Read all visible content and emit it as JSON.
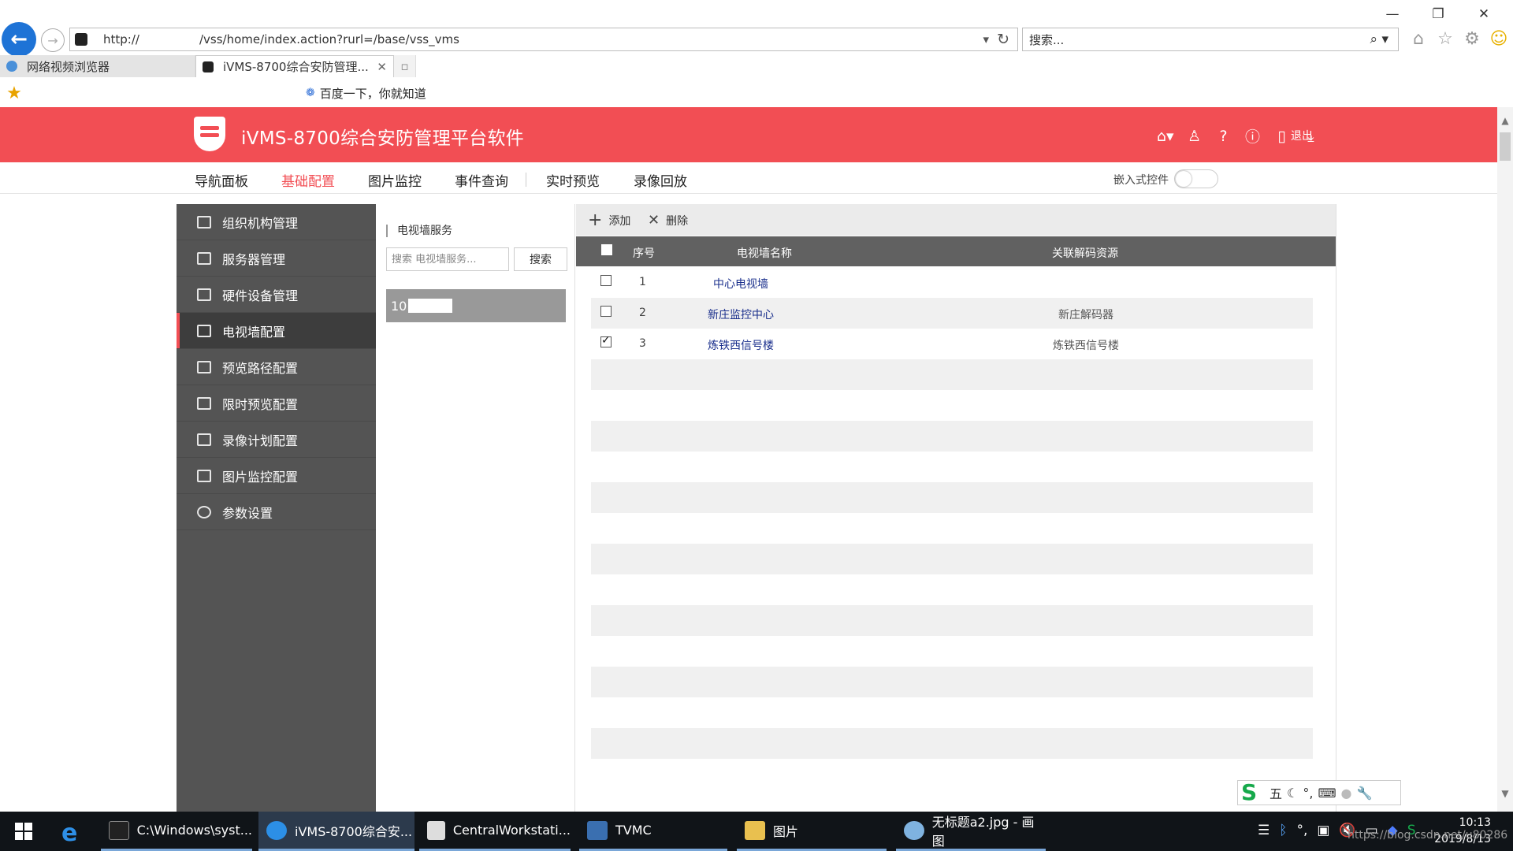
{
  "browser": {
    "url_visible_start": "http://",
    "url_path": "/vss/home/index.action?rurl=/base/vss_vms",
    "search_placeholder": "搜索...",
    "tabs": [
      {
        "label": "网络视频浏览器",
        "active": false
      },
      {
        "label": "iVMS-8700综合安防管理...",
        "active": true
      }
    ],
    "favorites": [
      {
        "label": "百度一下，你就知道"
      }
    ],
    "window_controls": [
      "—",
      "❐",
      "✕"
    ]
  },
  "app": {
    "title": "iVMS-8700综合安防管理平台软件",
    "logout_label": "退出",
    "accent": "#f24e54",
    "header_icons": [
      "home-icon",
      "user-icon",
      "help-icon",
      "info-icon",
      "bookmark-icon",
      "download-icon"
    ]
  },
  "menu": {
    "items": [
      {
        "label": "导航面板",
        "active": false
      },
      {
        "label": "基础配置",
        "active": true
      },
      {
        "label": "图片监控",
        "active": false
      },
      {
        "label": "事件查询",
        "active": false
      },
      {
        "label": "实时预览",
        "active": false
      },
      {
        "label": "录像回放",
        "active": false
      }
    ],
    "embed_label": "嵌入式控件",
    "embed_on": false
  },
  "sidebar": {
    "items": [
      {
        "label": "组织机构管理",
        "icon": "org-icon"
      },
      {
        "label": "服务器管理",
        "icon": "server-icon"
      },
      {
        "label": "硬件设备管理",
        "icon": "hardware-icon"
      },
      {
        "label": "电视墙配置",
        "icon": "monitor-icon",
        "active": true
      },
      {
        "label": "预览路径配置",
        "icon": "preview-path-icon"
      },
      {
        "label": "限时预览配置",
        "icon": "timed-preview-icon"
      },
      {
        "label": "录像计划配置",
        "icon": "record-plan-icon"
      },
      {
        "label": "图片监控配置",
        "icon": "picture-monitor-icon"
      },
      {
        "label": "参数设置",
        "icon": "gear-icon"
      }
    ]
  },
  "middle": {
    "title": "电视墙服务",
    "search_placeholder": "搜索 电视墙服务...",
    "search_button": "搜索",
    "selected_item_prefix": "10"
  },
  "toolbar": {
    "add_label": "添加",
    "delete_label": "删除"
  },
  "table": {
    "columns": [
      "序号",
      "电视墙名称",
      "关联解码资源"
    ],
    "rows": [
      {
        "index": "1",
        "name": "中心电视墙",
        "resource": "",
        "checked": false
      },
      {
        "index": "2",
        "name": "新庄监控中心",
        "resource": "新庄解码器",
        "checked": false
      },
      {
        "index": "3",
        "name": "炼铁西信号楼",
        "resource": "炼铁西信号楼",
        "checked": true
      }
    ]
  },
  "ime": {
    "mode": "五"
  },
  "taskbar": {
    "items": [
      {
        "label": "C:\\Windows\\syst..."
      },
      {
        "label": "iVMS-8700综合安..."
      },
      {
        "label": "CentralWorkstati..."
      },
      {
        "label": "TVMC"
      },
      {
        "label": "图片"
      },
      {
        "label": "无标题a2.jpg - 画图"
      }
    ],
    "time": "10:13",
    "date": "2019/8/13",
    "watermark": "https://blog.csdn.net/u80286"
  }
}
